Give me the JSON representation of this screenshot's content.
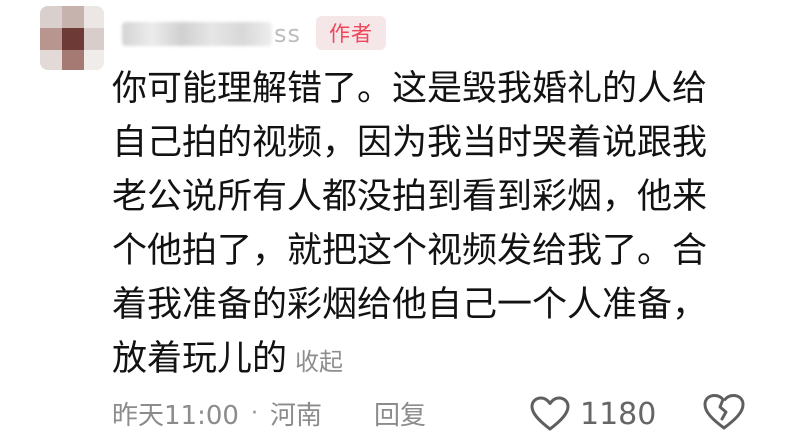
{
  "comment": {
    "username_visible_suffix": "ss",
    "author_badge": "作者",
    "body_lines": [
      "你可能理解错了。这是毁我婚礼的人给",
      "自己拍的视频，因为我当时哭着说跟我",
      "老公说所有人都没拍到看到彩烟，他来",
      "个他拍了，就把这个视频发给我了。合",
      "着我准备的彩烟给他自己一个人准备，",
      "放着玩儿的"
    ],
    "collapse_label": "收起",
    "time": "昨天11:00",
    "separator": "·",
    "location": "河南",
    "reply_label": "回复",
    "like_count": "1180",
    "icons": {
      "like": "heart-outline-icon",
      "dislike": "broken-heart-icon"
    },
    "colors": {
      "badge_text": "#f0465a",
      "badge_bg": "#f5e6e8",
      "meta_text": "#8c8c8c"
    }
  }
}
